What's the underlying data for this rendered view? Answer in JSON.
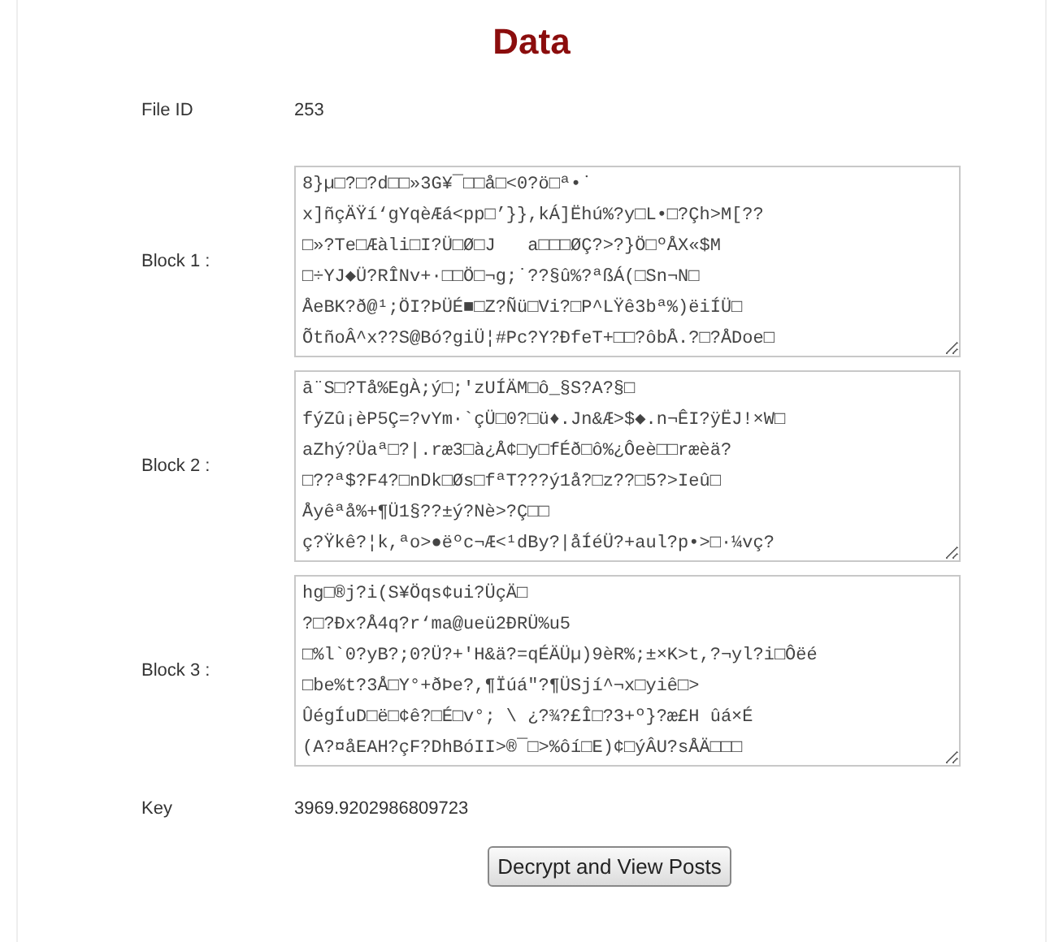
{
  "title": "Data",
  "file_id": {
    "label": "File ID",
    "value": "253"
  },
  "blocks": [
    {
      "label": "Block 1 :",
      "lines": [
        "8}µ□?□?d□□»3G¥¯□□å□<0?ö□ª•˙",
        "x]ñçÄŸí‘gYqèÆá<pp□’}},kÁ]Ëhú%?y□L•□?Çh>M[??",
        "□»?Te□Æàli□I?Ü□Ø□J   a□□□ØÇ?>?}Ö□ºÅX«$M",
        "□÷YJ◆Ü?RÎNv+·□□Ö□¬g;˙??§û%?ªßÁ(□Sn¬N□",
        "ÅeBK?ð@¹;ÖI?ÞÜÉ■□Z?Ñü□Vi?□P^LŸê3bª%)ëiÍÜ□",
        "ÕtñoÂ^x??S@Bó?giÜ¦#Pc?Y?ÐfeT+□□?ôbÅ.?□?ÅDoe□"
      ]
    },
    {
      "label": "Block 2 :",
      "lines": [
        "ā¨S□?Tå%EgÀ;ý□;'zUÍÄM□ô_§S?A?§□",
        "fýZû¡èP5Ç=?vYm·`çÜ□0?□ü♦.Jn&Æ>$◆.n¬ÊI?ÿËJ!×W□",
        "aZhý?Üaª□?|.ræ3□à¿Å¢□y□fÉð□ô%¿Ôeè□□ræèä?",
        "□??ª$?F4?□nDk□Øs□fªT???ý1å?□z??□5?>Ieû□",
        "Åyêªå%+¶Ü1§??±ý?Nè>?Ç□□",
        "ç?Ÿkê?¦k,ªo>●ëºc¬Æ<¹dBy?|åÍéÜ?+aul?p•>□·¼vç?"
      ]
    },
    {
      "label": "Block 3 :",
      "lines": [
        "hg□®j?i(S¥Öqs¢ui?ÜçÄ□",
        "?□?Ðx?Å4q?r‘ma@ueü2ÐRÜ%u5",
        "□%l`0?yB?;0?Ü?+'H&ä?=qÉÄÜµ)9èR%;±×K>t,?¬yl?i□Ôëé",
        "□be%t?3Å□Y°+ðÞe?,¶Ïúá\"?¶ÜSjí^¬x□yiê□>",
        "ÛégÍuD□ë□¢ê?□É□v°; \\ ¿?¾?£Î□?3+º}?æ£H ûá×É",
        "(A?¤åEAH?çF?DhBóII>®¯□>%ôí□E)¢□ýÂU?sÅÄ□□□"
      ]
    }
  ],
  "key": {
    "label": "Key",
    "value": "3969.9202986809723"
  },
  "button": "Decrypt and View Posts"
}
